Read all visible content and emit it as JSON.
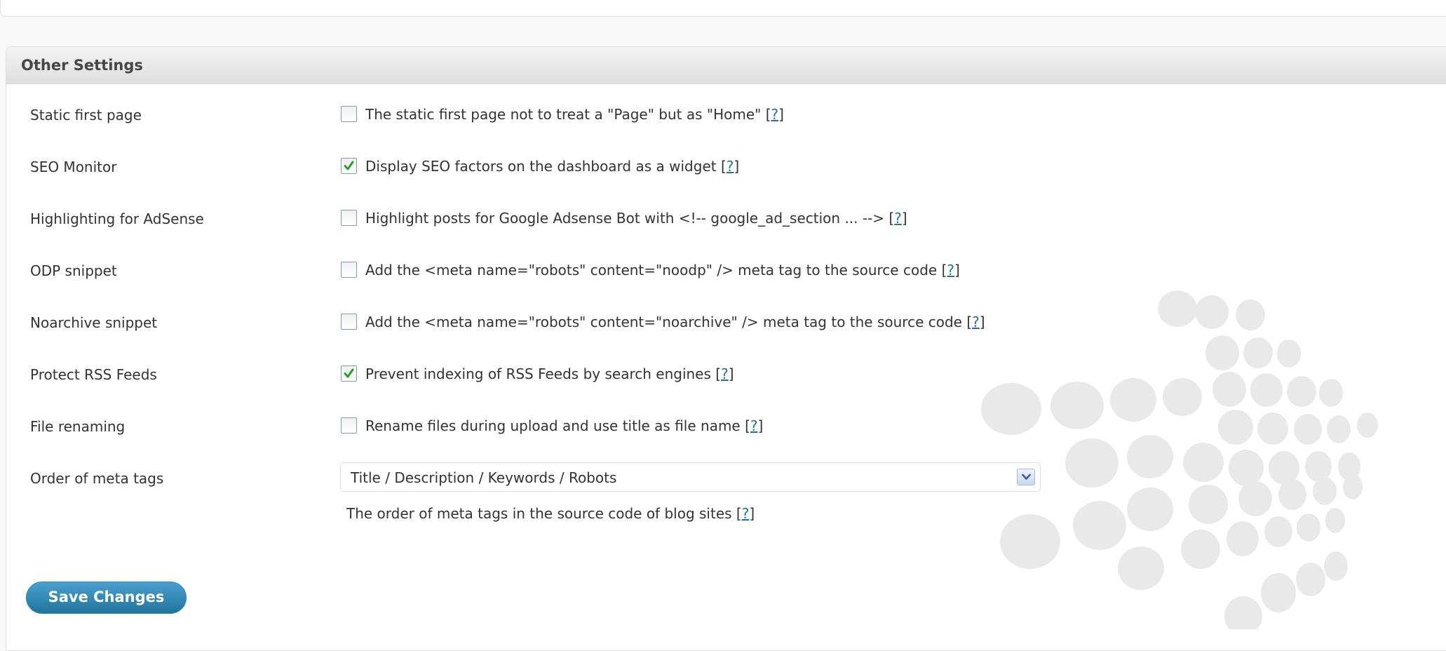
{
  "section": {
    "title": "Other Settings"
  },
  "settings": [
    {
      "label": "Static first page",
      "checked": false,
      "text": "The static first page not to treat a \"Page\" but as \"Home\" ",
      "help": "?"
    },
    {
      "label": "SEO Monitor",
      "checked": true,
      "text": "Display SEO factors on the dashboard as a widget ",
      "help": "?"
    },
    {
      "label": "Highlighting for AdSense",
      "checked": false,
      "text": "Highlight posts for Google Adsense Bot with <!-- google_ad_section ... --> ",
      "help": "?"
    },
    {
      "label": "ODP snippet",
      "checked": false,
      "text": "Add the <meta name=\"robots\" content=\"noodp\" /> meta tag to the source code ",
      "help": "?"
    },
    {
      "label": "Noarchive snippet",
      "checked": false,
      "text": "Add the <meta name=\"robots\" content=\"noarchive\" /> meta tag to the source code ",
      "help": "?"
    },
    {
      "label": "Protect RSS Feeds",
      "checked": true,
      "text": "Prevent indexing of RSS Feeds by search engines ",
      "help": "?"
    },
    {
      "label": "File renaming",
      "checked": false,
      "text": "Rename files during upload and use title as file name ",
      "help": "?"
    }
  ],
  "meta_order": {
    "label": "Order of meta tags",
    "selected": "Title / Description / Keywords / Robots",
    "description": "The order of meta tags in the source code of blog sites ",
    "help": "?"
  },
  "actions": {
    "save_label": "Save Changes"
  },
  "icons": {
    "checkbox_checked": "check-icon",
    "select_arrow": "chevron-down-icon"
  },
  "colors": {
    "link": "#21759b",
    "button": "#21759b",
    "check": "#2a9d2a"
  }
}
